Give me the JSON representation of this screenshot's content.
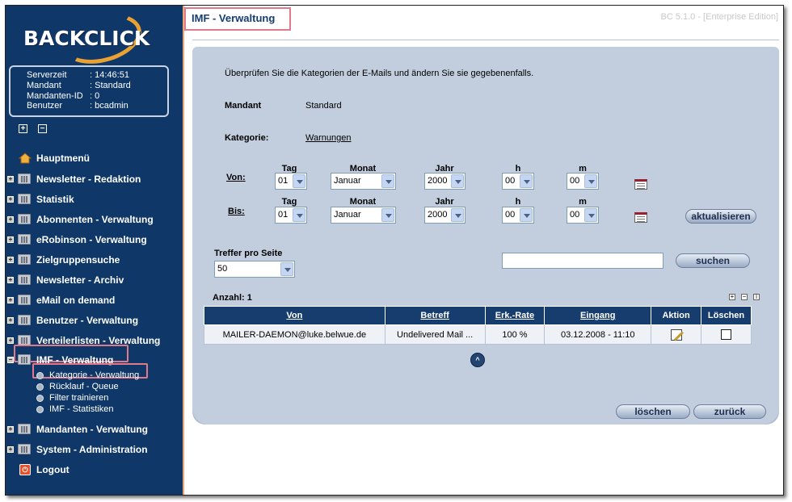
{
  "logo": "BACKCLICK",
  "version": "BC 5.1.0 - [Enterprise Edition]",
  "info": [
    {
      "k": "Serverzeit",
      "v": ": 14:46:51"
    },
    {
      "k": "Mandant",
      "v": ": Standard"
    },
    {
      "k": "Mandanten-ID",
      "v": ": 0"
    },
    {
      "k": "Benutzer",
      "v": ": bcadmin"
    }
  ],
  "nav": {
    "hauptmenu": "Hauptmenü",
    "items": [
      "Newsletter - Redaktion",
      "Statistik",
      "Abonnenten - Verwaltung",
      "eRobinson - Verwaltung",
      "Zielgruppensuche",
      "Newsletter - Archiv",
      "eMail on demand",
      "Benutzer - Verwaltung",
      "Verteilerlisten - Verwaltung",
      "IMF - Verwaltung"
    ],
    "sub": [
      "Kategorie - Verwaltung",
      "Rücklauf - Queue",
      "Filter trainieren",
      "IMF - Statistiken"
    ],
    "bottom": [
      "Mandanten - Verwaltung",
      "System - Administration"
    ],
    "logout": "Logout"
  },
  "page_title": "IMF - Verwaltung",
  "intro": "Überprüfen Sie die Kategorien der E-Mails und ändern Sie sie gegebenenfalls.",
  "mandant_label": "Mandant",
  "mandant_value": "Standard",
  "kategorie_label": "Kategorie:",
  "kategorie_value": "Warnungen",
  "date_headers": {
    "tag": "Tag",
    "monat": "Monat",
    "jahr": "Jahr",
    "h": "h",
    "m": "m"
  },
  "von": {
    "label": "Von:",
    "tag": "01",
    "monat": "Januar",
    "jahr": "2000",
    "h": "00",
    "m": "00"
  },
  "bis": {
    "label": "Bis:",
    "tag": "01",
    "monat": "Januar",
    "jahr": "2000",
    "h": "00",
    "m": "00"
  },
  "btn_aktualisieren": "aktualisieren",
  "treffer_label": "Treffer pro Seite",
  "treffer_value": "50",
  "search_value": "",
  "btn_suchen": "suchen",
  "anzahl": "Anzahl: 1",
  "table": {
    "headers": [
      "Von",
      "Betreff",
      "Erk.-Rate",
      "Eingang",
      "Aktion",
      "Löschen"
    ],
    "rows": [
      [
        "MAILER-DAEMON@luke.belwue.de",
        "Undelivered Mail ...",
        "100 %",
        "03.12.2008 - 11:10"
      ]
    ]
  },
  "btn_loeschen": "löschen",
  "btn_zurueck": "zurück"
}
